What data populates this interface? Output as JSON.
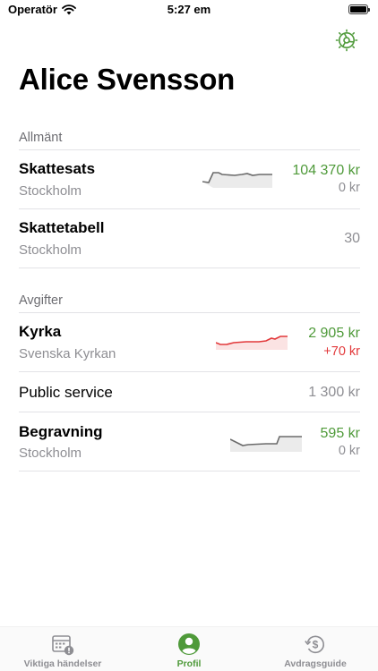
{
  "status_bar": {
    "carrier": "Operatör",
    "time": "5:27 em"
  },
  "page_title": "Alice Svensson",
  "colors": {
    "accent": "#4f9a3a",
    "negative": "#e2393b",
    "secondary": "#8e8e93"
  },
  "sections": {
    "general": {
      "header": "Allmänt",
      "skattesats": {
        "title": "Skattesats",
        "subtitle": "Stockholm",
        "value": "104 370 kr",
        "change": "0 kr"
      },
      "skattetabell": {
        "title": "Skattetabell",
        "subtitle": "Stockholm",
        "value": "30"
      }
    },
    "fees": {
      "header": "Avgifter",
      "kyrka": {
        "title": "Kyrka",
        "subtitle": "Svenska Kyrkan",
        "value": "2 905 kr",
        "change": "+70 kr"
      },
      "public_service": {
        "title": "Public service",
        "value": "1 300 kr"
      },
      "begravning": {
        "title": "Begravning",
        "subtitle": "Stockholm",
        "value": "595 kr",
        "change": "0 kr"
      }
    }
  },
  "tab_bar": {
    "tabs": [
      {
        "label": "Viktiga händelser",
        "icon": "calendar-alert-icon",
        "active": false
      },
      {
        "label": "Profil",
        "icon": "person-circle-icon",
        "active": true
      },
      {
        "label": "Avdragsguide",
        "icon": "dollar-refresh-icon",
        "active": false
      }
    ]
  }
}
